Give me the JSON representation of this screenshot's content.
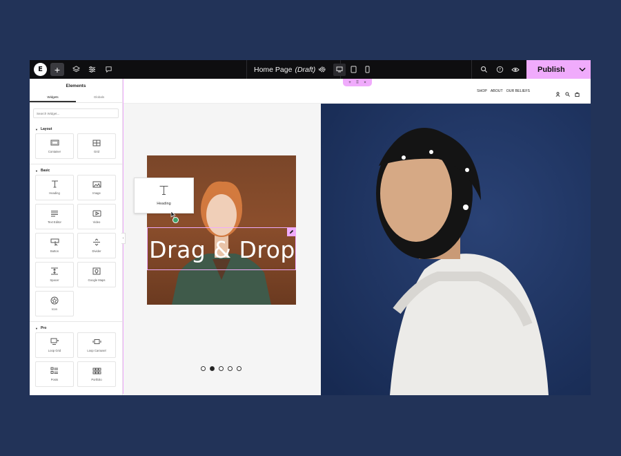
{
  "topbar": {
    "logo": "E",
    "add": "+",
    "doc_title": "Home Page",
    "doc_status": "(Draft)",
    "publish_label": "Publish",
    "icons": [
      "layers-icon",
      "settings-sliders-icon",
      "comments-icon",
      "gear-icon",
      "desktop-icon",
      "tablet-icon",
      "mobile-icon",
      "search-icon",
      "help-icon",
      "preview-eye-icon"
    ],
    "accent_color": "#f0abfc"
  },
  "panel": {
    "title": "Elements",
    "tabs": [
      "Widgets",
      "Globals"
    ],
    "search_placeholder": "Search Widget...",
    "sections": [
      {
        "name": "Layout",
        "widgets": [
          "Container",
          "Grid"
        ]
      },
      {
        "name": "Basic",
        "widgets": [
          "Heading",
          "Image",
          "Text Editor",
          "Video",
          "Button",
          "Divider",
          "Spacer",
          "Google Maps",
          "Icon"
        ]
      },
      {
        "name": "Pro",
        "widgets": [
          "Loop Grid",
          "Loop Carousel",
          "Posts",
          "Portfolio"
        ]
      }
    ]
  },
  "canvas": {
    "nav": [
      "SHOP",
      "ABOUT",
      "OUR BELIEFS"
    ],
    "headline": "Drag & Drop",
    "drag_widget": "Heading",
    "slider_dots": 5,
    "slider_active": 2
  }
}
